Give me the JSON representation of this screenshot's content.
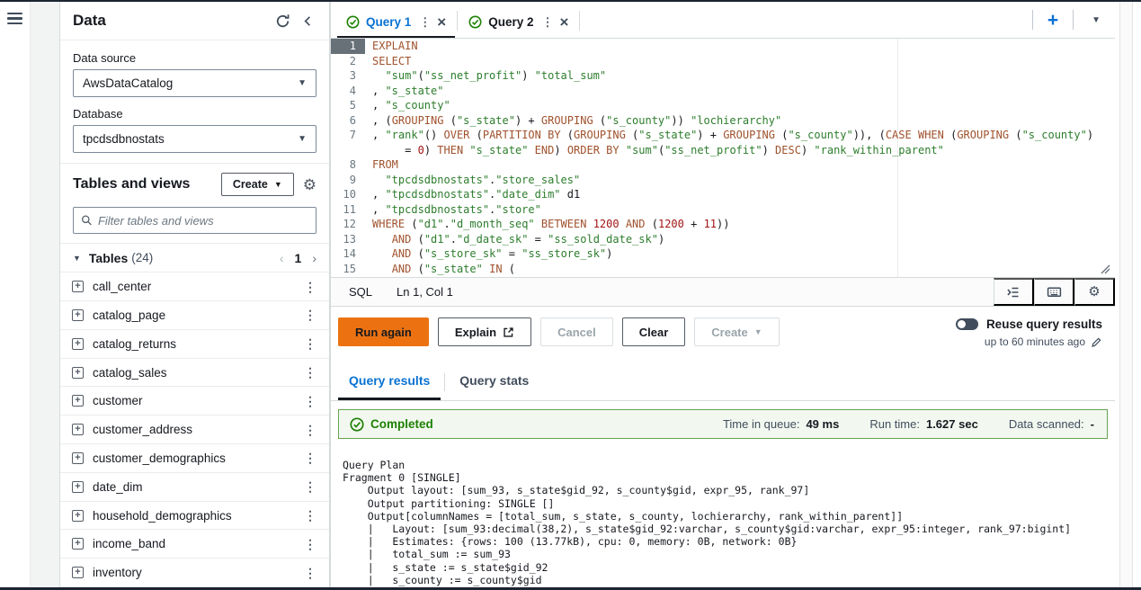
{
  "sidebar": {
    "title": "Data",
    "data_source_label": "Data source",
    "data_source_value": "AwsDataCatalog",
    "database_label": "Database",
    "database_value": "tpcdsdbnostats",
    "tables_heading": "Tables and views",
    "create_label": "Create",
    "filter_placeholder": "Filter tables and views",
    "tables_section_label": "Tables",
    "tables_section_count": "(24)",
    "page_number": "1",
    "tables": [
      "call_center",
      "catalog_page",
      "catalog_returns",
      "catalog_sales",
      "customer",
      "customer_address",
      "customer_demographics",
      "date_dim",
      "household_demographics",
      "income_band",
      "inventory"
    ]
  },
  "query_tabs": [
    {
      "label": "Query 1",
      "active": true
    },
    {
      "label": "Query 2",
      "active": false
    }
  ],
  "editor": {
    "language": "SQL",
    "cursor": "Ln 1, Col 1",
    "lines": [
      {
        "n": "1",
        "segs": [
          [
            "EXPLAIN",
            "k"
          ]
        ]
      },
      {
        "n": "2",
        "segs": [
          [
            "SELECT",
            "k"
          ]
        ]
      },
      {
        "n": "3",
        "segs": [
          [
            "  ",
            "p"
          ],
          [
            "\"sum\"",
            "s"
          ],
          [
            "(",
            "p"
          ],
          [
            "\"ss_net_profit\"",
            "s"
          ],
          [
            ") ",
            "p"
          ],
          [
            "\"total_sum\"",
            "s"
          ]
        ]
      },
      {
        "n": "4",
        "segs": [
          [
            ", ",
            "p"
          ],
          [
            "\"s_state\"",
            "s"
          ]
        ]
      },
      {
        "n": "5",
        "segs": [
          [
            ", ",
            "p"
          ],
          [
            "\"s_county\"",
            "s"
          ]
        ]
      },
      {
        "n": "6",
        "segs": [
          [
            ", (",
            "p"
          ],
          [
            "GROUPING",
            "k"
          ],
          [
            " (",
            "p"
          ],
          [
            "\"s_state\"",
            "s"
          ],
          [
            ") + ",
            "p"
          ],
          [
            "GROUPING",
            "k"
          ],
          [
            " (",
            "p"
          ],
          [
            "\"s_county\"",
            "s"
          ],
          [
            ")) ",
            "p"
          ],
          [
            "\"lochierarchy\"",
            "s"
          ]
        ]
      },
      {
        "n": "7",
        "segs": [
          [
            ", ",
            "p"
          ],
          [
            "\"rank\"",
            "s"
          ],
          [
            "() ",
            "p"
          ],
          [
            "OVER",
            "k"
          ],
          [
            " (",
            "p"
          ],
          [
            "PARTITION BY",
            "k"
          ],
          [
            " (",
            "p"
          ],
          [
            "GROUPING",
            "k"
          ],
          [
            " (",
            "p"
          ],
          [
            "\"s_state\"",
            "s"
          ],
          [
            ") + ",
            "p"
          ],
          [
            "GROUPING",
            "k"
          ],
          [
            " (",
            "p"
          ],
          [
            "\"s_county\"",
            "s"
          ],
          [
            ")), (",
            "p"
          ],
          [
            "CASE",
            "k"
          ],
          [
            " ",
            "p"
          ],
          [
            "WHEN",
            "k"
          ],
          [
            " (",
            "p"
          ],
          [
            "GROUPING",
            "k"
          ],
          [
            " (",
            "p"
          ],
          [
            "\"s_county\"",
            "s"
          ],
          [
            ")",
            "p"
          ]
        ]
      },
      {
        "n": "",
        "segs": [
          [
            "     = ",
            "p"
          ],
          [
            "0",
            "n"
          ],
          [
            ") ",
            "p"
          ],
          [
            "THEN",
            "k"
          ],
          [
            " ",
            "p"
          ],
          [
            "\"s_state\"",
            "s"
          ],
          [
            " ",
            "p"
          ],
          [
            "END",
            "k"
          ],
          [
            ") ",
            "p"
          ],
          [
            "ORDER BY",
            "k"
          ],
          [
            " ",
            "p"
          ],
          [
            "\"sum\"",
            "s"
          ],
          [
            "(",
            "p"
          ],
          [
            "\"ss_net_profit\"",
            "s"
          ],
          [
            ") ",
            "p"
          ],
          [
            "DESC",
            "k"
          ],
          [
            ") ",
            "p"
          ],
          [
            "\"rank_within_parent\"",
            "s"
          ]
        ]
      },
      {
        "n": "8",
        "segs": [
          [
            "FROM",
            "k"
          ]
        ]
      },
      {
        "n": "9",
        "segs": [
          [
            "  ",
            "p"
          ],
          [
            "\"tpcdsdbnostats\"",
            "s"
          ],
          [
            ".",
            "p"
          ],
          [
            "\"store_sales\"",
            "s"
          ]
        ]
      },
      {
        "n": "10",
        "segs": [
          [
            ", ",
            "p"
          ],
          [
            "\"tpcdsdbnostats\"",
            "s"
          ],
          [
            ".",
            "p"
          ],
          [
            "\"date_dim\"",
            "s"
          ],
          [
            " d1",
            "p"
          ]
        ]
      },
      {
        "n": "11",
        "segs": [
          [
            ", ",
            "p"
          ],
          [
            "\"tpcdsdbnostats\"",
            "s"
          ],
          [
            ".",
            "p"
          ],
          [
            "\"store\"",
            "s"
          ]
        ]
      },
      {
        "n": "12",
        "segs": [
          [
            "WHERE",
            "k"
          ],
          [
            " (",
            "p"
          ],
          [
            "\"d1\"",
            "s"
          ],
          [
            ".",
            "p"
          ],
          [
            "\"d_month_seq\"",
            "s"
          ],
          [
            " ",
            "p"
          ],
          [
            "BETWEEN",
            "k"
          ],
          [
            " ",
            "p"
          ],
          [
            "1200",
            "n"
          ],
          [
            " ",
            "p"
          ],
          [
            "AND",
            "k"
          ],
          [
            " (",
            "p"
          ],
          [
            "1200",
            "n"
          ],
          [
            " + ",
            "p"
          ],
          [
            "11",
            "n"
          ],
          [
            "))",
            "p"
          ]
        ]
      },
      {
        "n": "13",
        "segs": [
          [
            "   ",
            "p"
          ],
          [
            "AND",
            "k"
          ],
          [
            " (",
            "p"
          ],
          [
            "\"d1\"",
            "s"
          ],
          [
            ".",
            "p"
          ],
          [
            "\"d_date_sk\"",
            "s"
          ],
          [
            " = ",
            "p"
          ],
          [
            "\"ss_sold_date_sk\"",
            "s"
          ],
          [
            ")",
            "p"
          ]
        ]
      },
      {
        "n": "14",
        "segs": [
          [
            "   ",
            "p"
          ],
          [
            "AND",
            "k"
          ],
          [
            " (",
            "p"
          ],
          [
            "\"s_store_sk\"",
            "s"
          ],
          [
            " = ",
            "p"
          ],
          [
            "\"ss_store_sk\"",
            "s"
          ],
          [
            ")",
            "p"
          ]
        ]
      },
      {
        "n": "15",
        "segs": [
          [
            "   ",
            "p"
          ],
          [
            "AND",
            "k"
          ],
          [
            " (",
            "p"
          ],
          [
            "\"s_state\"",
            "s"
          ],
          [
            " ",
            "p"
          ],
          [
            "IN",
            "k"
          ],
          [
            " (",
            "p"
          ]
        ]
      }
    ]
  },
  "actions": {
    "run": "Run again",
    "explain": "Explain",
    "cancel": "Cancel",
    "clear": "Clear",
    "create": "Create",
    "reuse_label": "Reuse query results",
    "reuse_note": "up to 60 minutes ago"
  },
  "results": {
    "tabs": [
      {
        "label": "Query results",
        "active": true
      },
      {
        "label": "Query stats",
        "active": false
      }
    ],
    "banner_status": "Completed",
    "stats": [
      {
        "label": "Time in queue:",
        "value": "49 ms"
      },
      {
        "label": "Run time:",
        "value": "1.627 sec"
      },
      {
        "label": "Data scanned:",
        "value": "-"
      }
    ],
    "plan": [
      "Query Plan",
      "Fragment 0 [SINGLE]",
      "    Output layout: [sum_93, s_state$gid_92, s_county$gid, expr_95, rank_97]",
      "    Output partitioning: SINGLE []",
      "    Output[columnNames = [total_sum, s_state, s_county, lochierarchy, rank_within_parent]]",
      "    |   Layout: [sum_93:decimal(38,2), s_state$gid_92:varchar, s_county$gid:varchar, expr_95:integer, rank_97:bigint]",
      "    |   Estimates: {rows: 100 (13.77kB), cpu: 0, memory: 0B, network: 0B}",
      "    |   total_sum := sum_93",
      "    |   s_state := s_state$gid_92",
      "    |   s_county := s_county$gid"
    ]
  },
  "colors": {
    "accent_blue": "#0972d3",
    "run_button_orange": "#ec7211",
    "success_green": "#1d8102"
  }
}
